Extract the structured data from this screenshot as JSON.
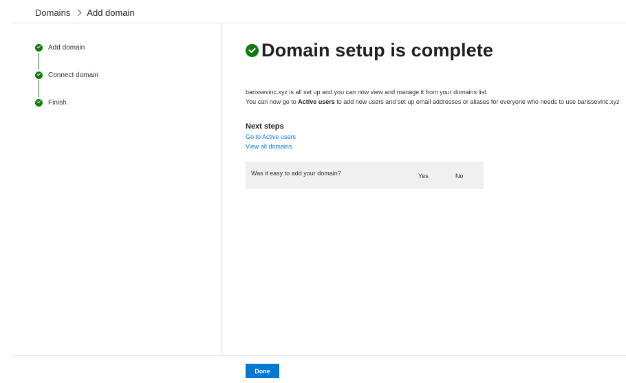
{
  "breadcrumb": {
    "parent": "Domains",
    "current": "Add domain"
  },
  "steps": [
    {
      "label": "Add domain",
      "status": "complete"
    },
    {
      "label": "Connect domain",
      "status": "complete"
    },
    {
      "label": "Finish",
      "status": "complete"
    }
  ],
  "main": {
    "title": "Domain setup is complete",
    "desc_line1": "barissevinc.xyz is all set up and you can now view and manage it from your domains list.",
    "desc_line2_pre": "You can now go to ",
    "desc_line2_bold": "Active users",
    "desc_line2_post": " to add new users and set up email addresses or aliases for everyone who needs to use barissevinc.xyz",
    "next_steps_title": "Next steps",
    "links": [
      "Go to Active users",
      "View all domains"
    ]
  },
  "feedback": {
    "question": "Was it easy to add your domain?",
    "yes": "Yes",
    "no": "No"
  },
  "footer": {
    "done_label": "Done"
  },
  "colors": {
    "success": "#107c10",
    "accent": "#0078d4",
    "feedback_bg": "#f0f0f0"
  }
}
